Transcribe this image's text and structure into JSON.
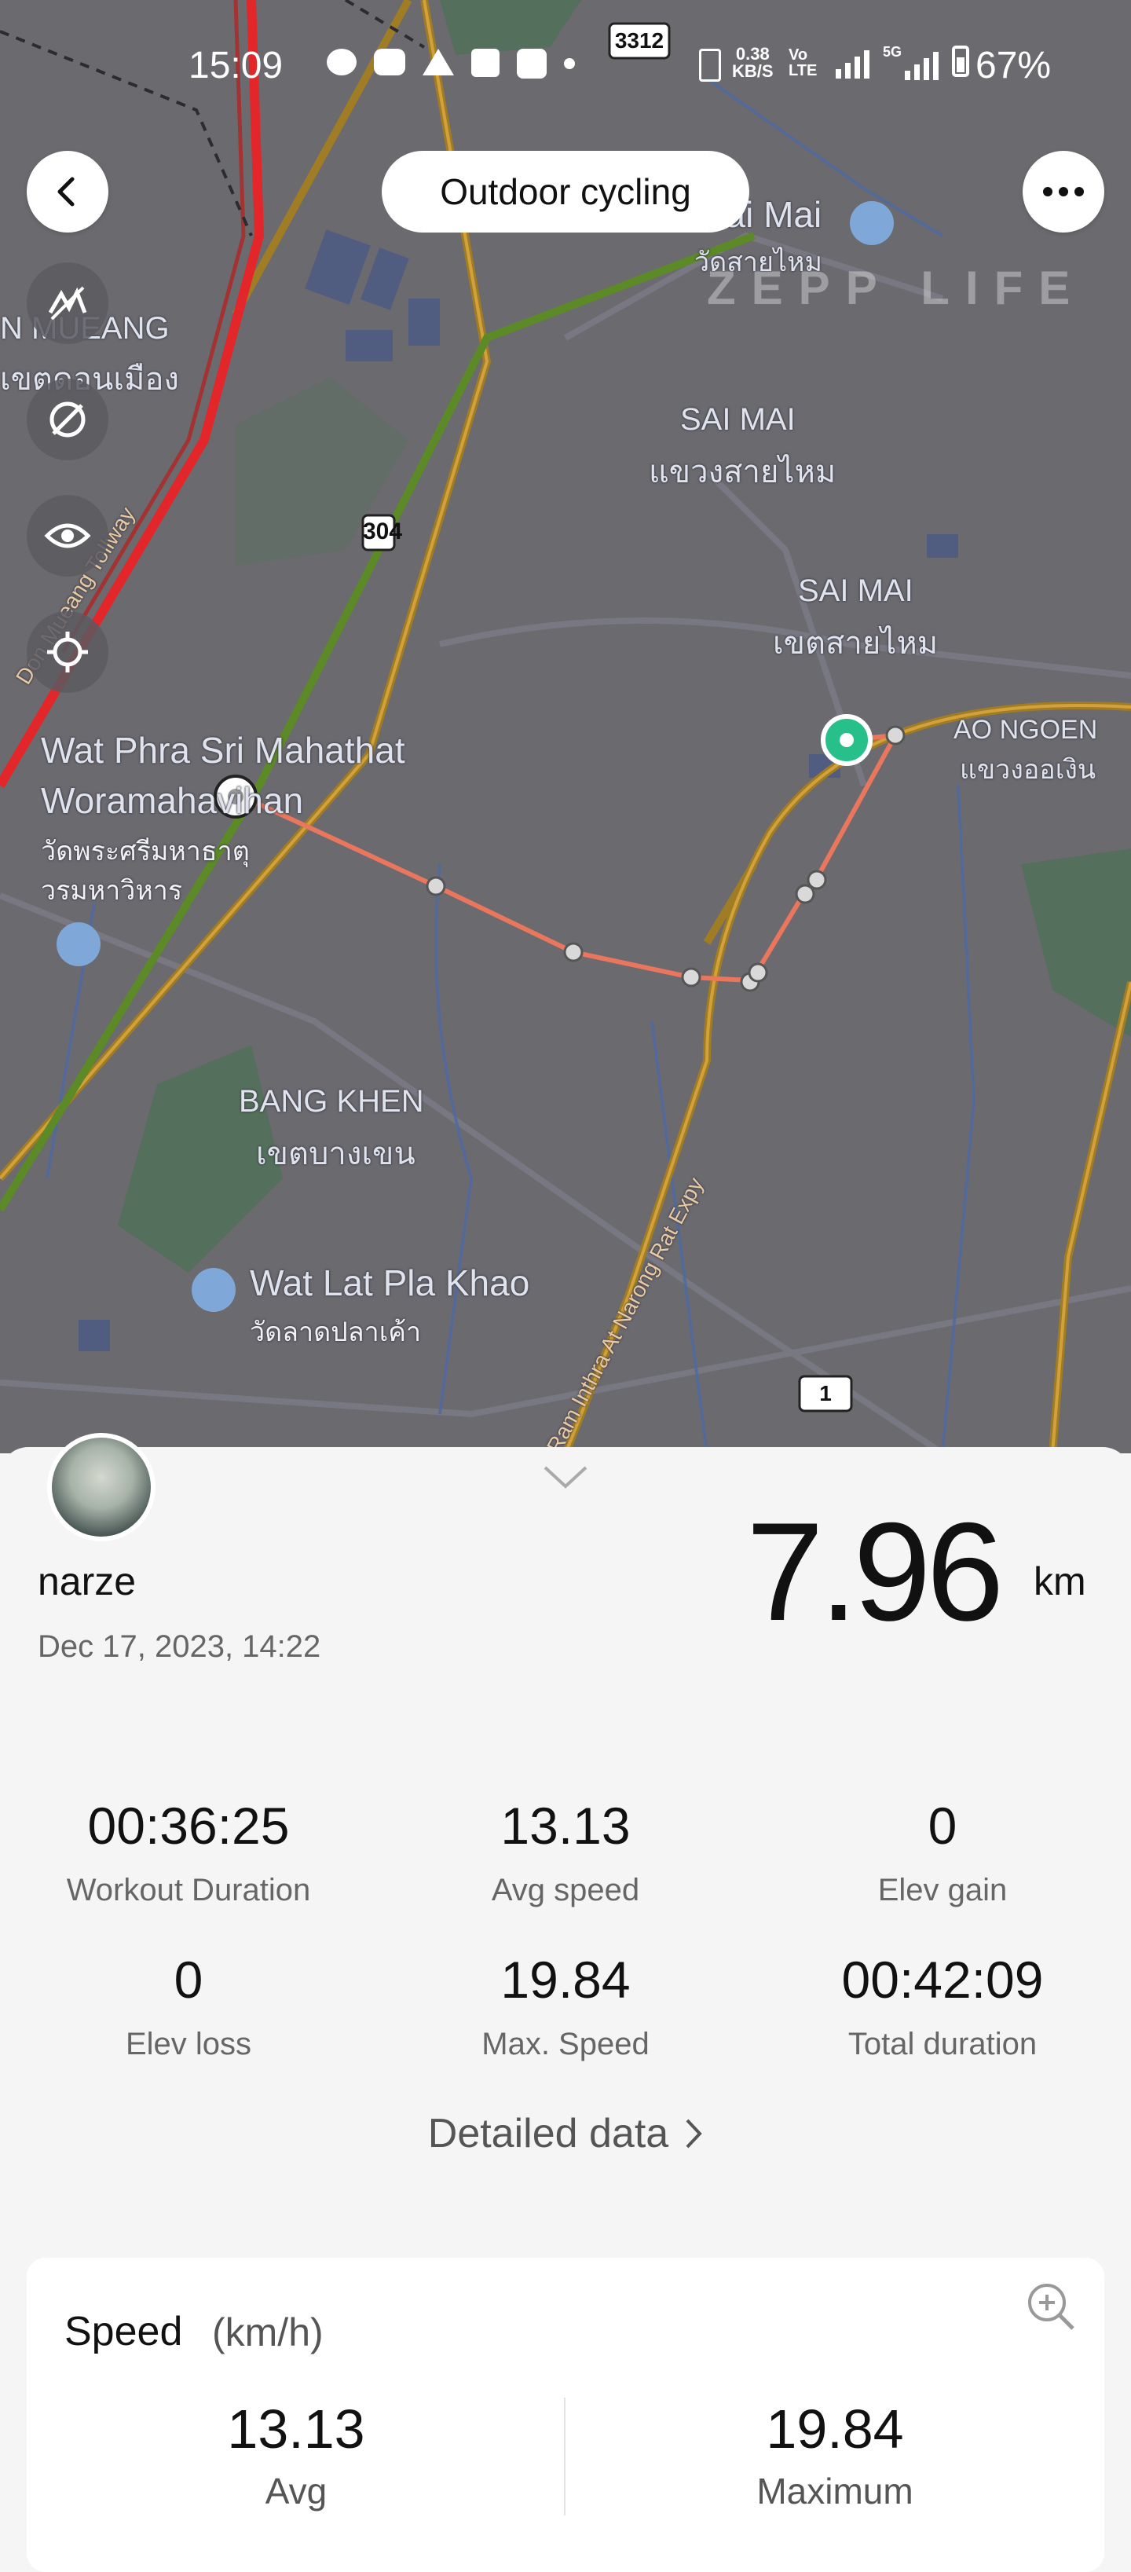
{
  "status_bar": {
    "time": "15:09",
    "speed_rate": "0.38",
    "speed_unit": "KB/S",
    "battery": "67%",
    "network_5g": "5G"
  },
  "header": {
    "title": "Outdoor cycling",
    "back_icon": "back-arrow-icon",
    "more_icon": "more-dots-icon"
  },
  "map": {
    "watermark": "ZEPP LIFE",
    "labels": [
      {
        "text": "N MUEANG",
        "id": "n-mueang"
      },
      {
        "text": "เขตดอนเมือง",
        "id": "don-mueang-th"
      },
      {
        "text": "SAI MAI",
        "id": "sai-mai-1"
      },
      {
        "text": "แขวงสายไหม",
        "id": "sai-mai-1-th"
      },
      {
        "text": "SAI MAI",
        "id": "sai-mai-2"
      },
      {
        "text": "เขตสายไหม",
        "id": "sai-mai-2-th"
      },
      {
        "text": "AO NGOEN",
        "id": "ao-ngoen"
      },
      {
        "text": "แขวงออเงิน",
        "id": "ao-ngoen-th"
      },
      {
        "text": "Wat Phra Sri Mahathat",
        "id": "wat-phra-1"
      },
      {
        "text": "Woramahavihan",
        "id": "wat-phra-2"
      },
      {
        "text": "วัดพระศรีมหาธาตุ",
        "id": "wat-phra-th1"
      },
      {
        "text": "วรมหาวิหาร",
        "id": "wat-phra-th2"
      },
      {
        "text": "BANG KHEN",
        "id": "bang-khen"
      },
      {
        "text": "เขตบางเขน",
        "id": "bang-khen-th"
      },
      {
        "text": "Wat Lat Pla Khao",
        "id": "wat-lat"
      },
      {
        "text": "วัดลาดปลาเค้า",
        "id": "wat-lat-th"
      },
      {
        "text": "Wat Sai Mai",
        "id": "wat-sai-mai"
      },
      {
        "text": "วัดสายไหม",
        "id": "wat-sai-mai-th"
      },
      {
        "text": "Don Mueang Tollway",
        "id": "tollway"
      },
      {
        "text": "Ram Inthra At Narong Rat Expy",
        "id": "expy"
      },
      {
        "text": "3312",
        "id": "shield-3312"
      },
      {
        "text": "1",
        "id": "shield-1"
      },
      {
        "text": "304",
        "id": "shield-304"
      }
    ]
  },
  "activity": {
    "user_name": "narze",
    "date": "Dec 17, 2023, 14:22",
    "distance": "7.96",
    "distance_unit": "km"
  },
  "stats": [
    {
      "value": "00:36:25",
      "label": "Workout Duration"
    },
    {
      "value": "13.13",
      "label": "Avg speed"
    },
    {
      "value": "0",
      "label": "Elev gain"
    },
    {
      "value": "0",
      "label": "Elev loss"
    },
    {
      "value": "19.84",
      "label": "Max. Speed"
    },
    {
      "value": "00:42:09",
      "label": "Total duration"
    }
  ],
  "detailed_link": "Detailed data",
  "speed_card": {
    "title": "Speed",
    "unit": "(km/h)",
    "avg_value": "13.13",
    "avg_label": "Avg",
    "max_value": "19.84",
    "max_label": "Maximum"
  },
  "colors": {
    "route": "#e9765d",
    "map_bg": "#6b6a6f",
    "start_marker": "#27c08a",
    "highway": "#b8861a"
  }
}
